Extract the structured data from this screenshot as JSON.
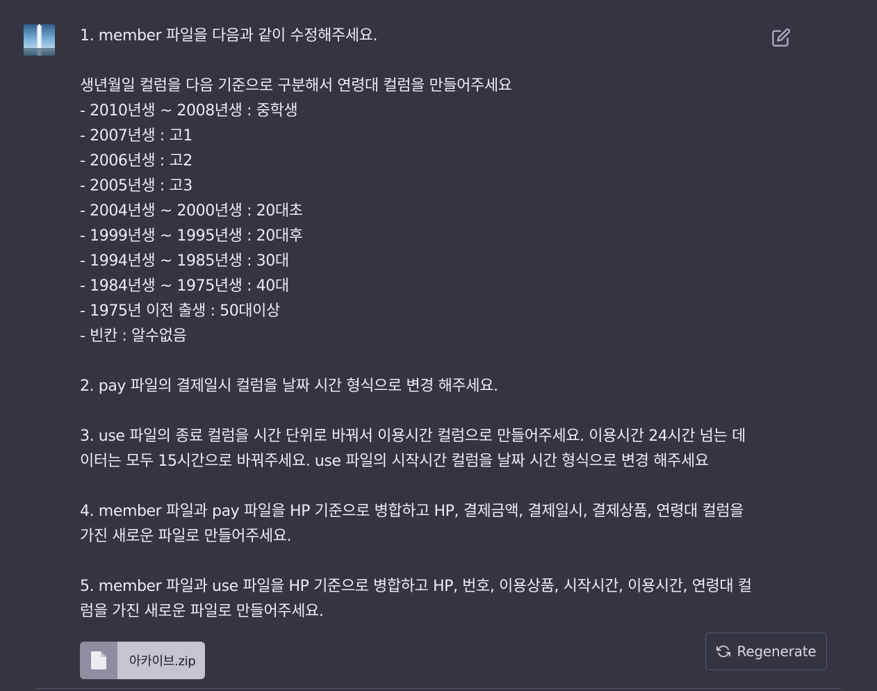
{
  "message": {
    "lines": [
      "1. member 파일을 다음과 같이 수정해주세요.",
      "",
      "생년월일 컬럼을 다음 기준으로 구분해서 연령대 컬럼을 만들어주세요",
      "- 2010년생 ~ 2008년생 : 중학생",
      "- 2007년생 : 고1",
      "- 2006년생 : 고2",
      "- 2005년생 : 고3",
      "- 2004년생 ~ 2000년생 : 20대초",
      "- 1999년생 ~ 1995년생 : 20대후",
      "- 1994년생 ~ 1985년생 : 30대",
      "- 1984년생 ~ 1975년생 : 40대",
      "- 1975년 이전 출생 : 50대이상",
      "- 빈칸 : 알수없음",
      "",
      "2. pay 파일의 결제일시 컬럼을 날짜 시간 형식으로 변경 해주세요.",
      "",
      "3. use 파일의 종료 컬럼을 시간 단위로 바꿔서 이용시간 컬럼으로 만들어주세요. 이용시간 24시간 넘는 데",
      "이터는 모두 15시간으로 바꿔주세요. use 파일의 시작시간 컬럼을 날짜 시간 형식으로 변경 해주세요",
      "",
      "4. member 파일과 pay 파일을 HP 기준으로 병합하고 HP, 결제금액, 결제일시, 결제상품, 연령대 컬럼을",
      "가진 새로운 파일로 만들어주세요.",
      "",
      "5. member 파일과 use 파일을 HP 기준으로 병합하고 HP, 번호, 이용상품, 시작시간, 이용시간, 연령대 컬",
      "럼을 가진 새로운 파일로 만들어주세요."
    ]
  },
  "attachment": {
    "file_name": "아카이브.zip",
    "icon": "file-icon"
  },
  "actions": {
    "regenerate_label": "Regenerate",
    "regenerate_icon": "refresh-icon",
    "edit_icon": "edit-icon"
  },
  "colors": {
    "background": "#343541",
    "text": "#ececf1",
    "attachment_bg": "#c5c5d2",
    "attachment_icon_bg": "#8e8ea0",
    "button_border": "#565869"
  }
}
